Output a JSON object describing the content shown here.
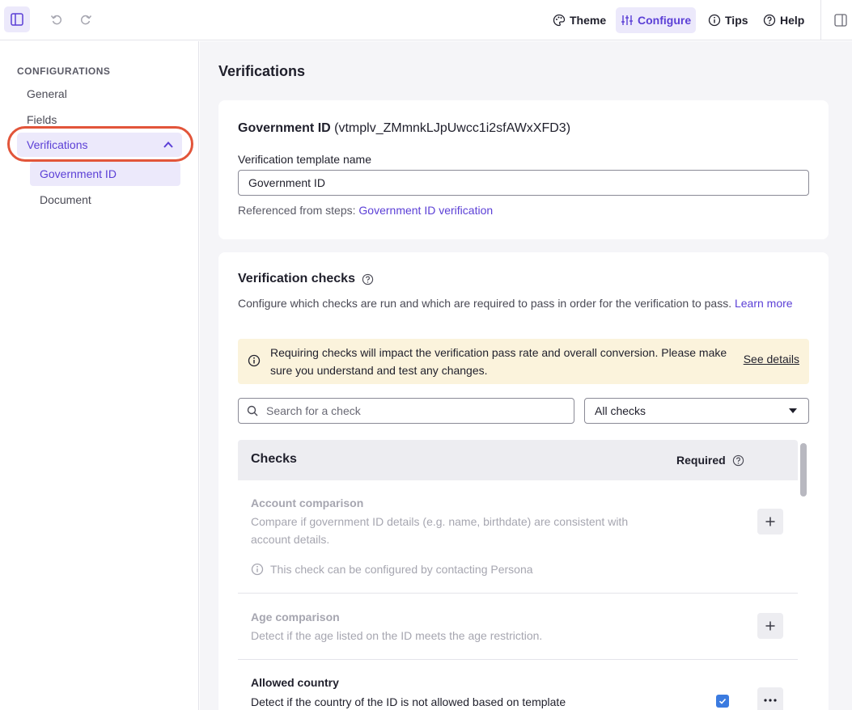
{
  "topbar": {
    "nav": {
      "theme": "Theme",
      "configure": "Configure",
      "tips": "Tips",
      "help": "Help"
    },
    "icons": [
      "sidebar-toggle-icon",
      "undo-icon",
      "redo-icon",
      "palette-icon",
      "sliders-icon",
      "info-icon",
      "help-icon",
      "panel-toggle-icon"
    ]
  },
  "sidebar": {
    "heading": "CONFIGURATIONS",
    "items": [
      "General",
      "Fields",
      "Verifications"
    ],
    "sub_items": [
      "Government ID",
      "Document"
    ]
  },
  "main": {
    "page_title": "Verifications",
    "template_card": {
      "title_bold": "Government ID",
      "title_id": "(vtmplv_ZMmnkLJpUwcc1i2sfAWxXFD3)",
      "field_label": "Verification template name",
      "field_value": "Government ID",
      "ref_prefix": "Referenced from steps:",
      "ref_link": "Government ID verification"
    },
    "checks_card": {
      "title": "Verification checks",
      "description": "Configure which checks are run and which are required to pass in order for the verification to pass.",
      "learn_more": "Learn more",
      "warning_text": "Requiring checks will impact the verification pass rate and overall conversion. Please make sure you understand and test any changes.",
      "warning_link": "See details",
      "search_placeholder": "Search for a check",
      "filter_value": "All checks",
      "table": {
        "col_checks": "Checks",
        "col_required": "Required",
        "rows": [
          {
            "name": "Account comparison",
            "description": "Compare if government ID details (e.g. name, birthdate) are consistent with account details.",
            "note": "This check can be configured by contacting Persona"
          },
          {
            "name": "Age comparison",
            "description": "Detect if the age listed on the ID meets the age restriction."
          },
          {
            "name": "Allowed country",
            "description": "Detect if the country of the ID is not allowed based on template",
            "required": true
          }
        ]
      }
    }
  },
  "colors": {
    "accent": "#5b3fd6",
    "accent_bg": "#ece9fb",
    "warning_bg": "#fbf3dc",
    "highlight_ring": "#e2553a",
    "checkbox": "#3b7be0"
  }
}
